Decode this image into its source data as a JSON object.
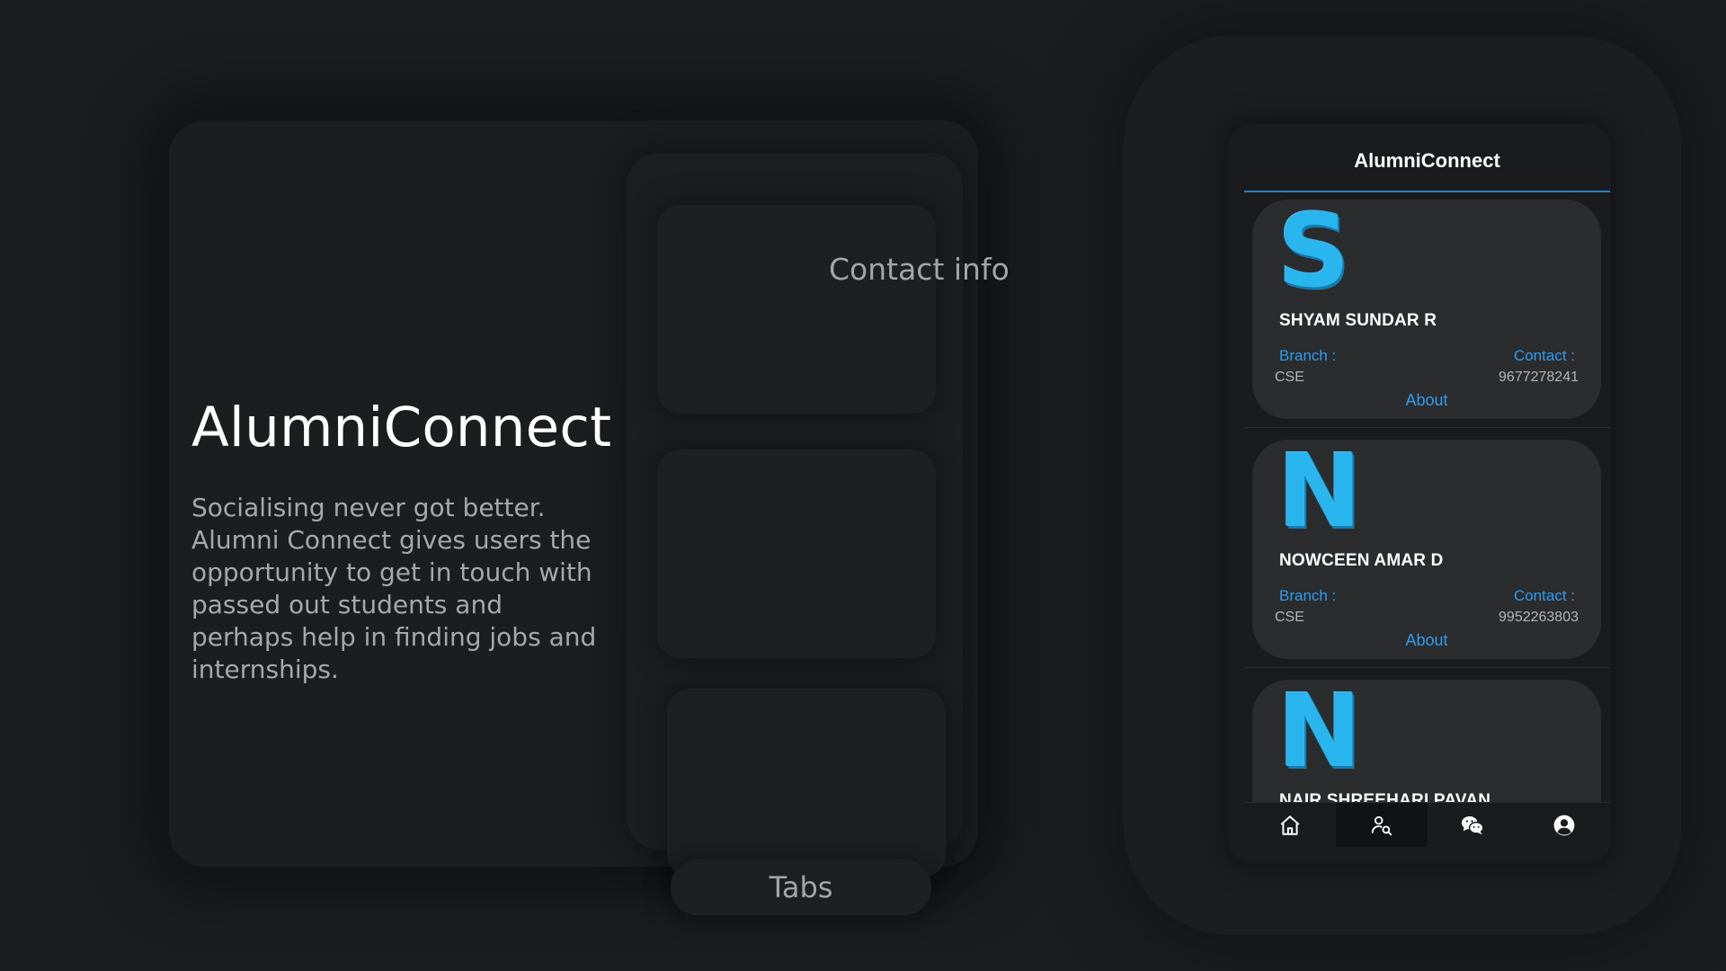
{
  "presentation": {
    "brand_title": "AlumniConnect",
    "tagline": "Socialising never got better.\nAlumni Connect gives users the opportunity to get in touch with passed out students and\nperhaps help in finding jobs and internships.",
    "contact_info_label": "Contact info",
    "tabs_label": "Tabs"
  },
  "app": {
    "title": "AlumniConnect",
    "accent_color": "#2e9cf0",
    "labels": {
      "branch": "Branch :",
      "contact": "Contact :",
      "about": "About"
    },
    "users": [
      {
        "initial": "S",
        "name": "SHYAM SUNDAR R",
        "branch": "CSE",
        "contact": "9677278241"
      },
      {
        "initial": "N",
        "name": "NOWCEEN AMAR D",
        "branch": "CSE",
        "contact": "9952263803"
      },
      {
        "initial": "N",
        "name": "NAIR SHREEHARI PAVAN"
      }
    ],
    "bottom_nav": [
      {
        "icon": "home-icon",
        "active": false
      },
      {
        "icon": "search-user-icon",
        "active": true
      },
      {
        "icon": "chat-icon",
        "active": false
      },
      {
        "icon": "profile-icon",
        "active": false
      }
    ]
  }
}
